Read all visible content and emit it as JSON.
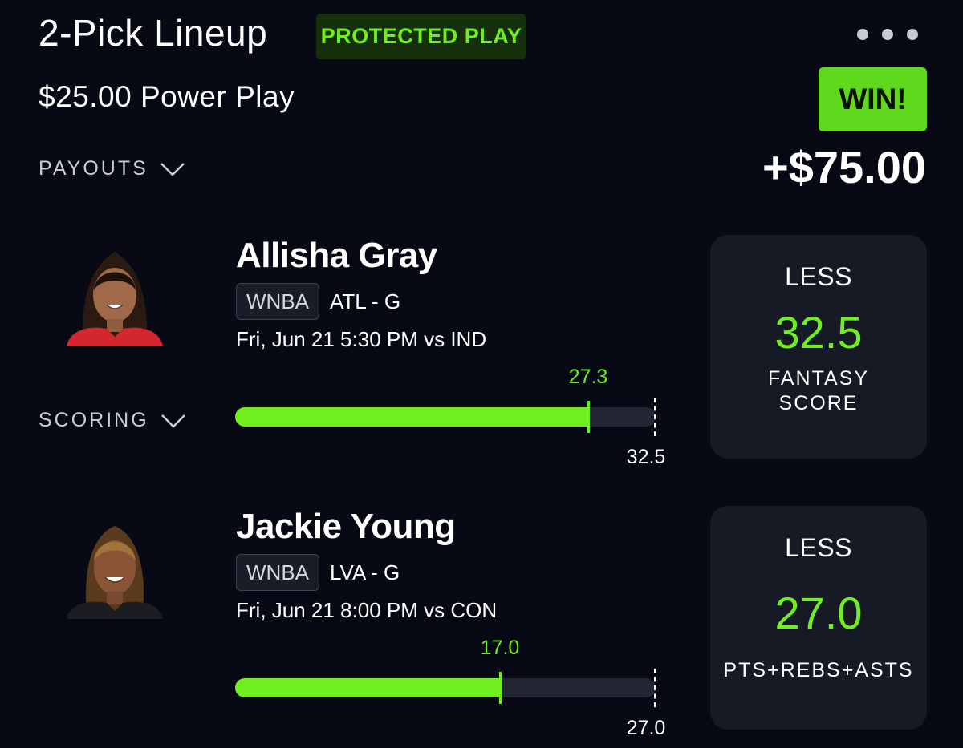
{
  "header": {
    "title": "2-Pick Lineup",
    "badge": "PROTECTED PLAY",
    "subtitle": "$25.00 Power Play",
    "result": "WIN!",
    "payout": "+$75.00"
  },
  "toggles": {
    "payouts_label": "PAYOUTS",
    "scoring_label": "SCORING"
  },
  "picks": [
    {
      "player": "Allisha Gray",
      "league": "WNBA",
      "team": "ATL - G",
      "game": "Fri, Jun 21 5:30 PM  vs IND",
      "actual": "27.3",
      "line": "32.5",
      "progress": 0.84,
      "direction": "LESS",
      "stat": "FANTASY SCORE",
      "jersey_color": "#d3262e"
    },
    {
      "player": "Jackie Young",
      "league": "WNBA",
      "team": "LVA - G",
      "game": "Fri, Jun 21 8:00 PM  vs CON",
      "actual": "17.0",
      "line": "27.0",
      "progress": 0.63,
      "direction": "LESS",
      "stat": "PTS+REBS+ASTS",
      "jersey_color": "#1b1d22"
    }
  ],
  "colors": {
    "accent": "#6ff01e",
    "win_bg": "#5fd81e",
    "background": "#070a14",
    "card": "#161a25"
  }
}
